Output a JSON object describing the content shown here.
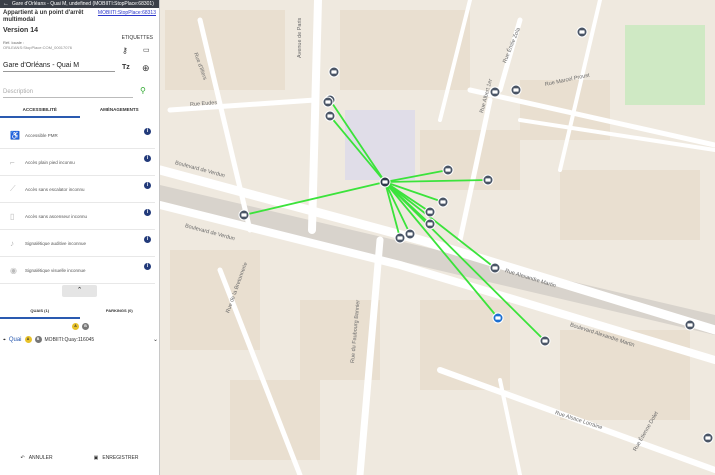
{
  "window": {
    "title": "Gare d'Orléans - Quai M, undefined (MOBIITI:StopPlace:68301)"
  },
  "header": {
    "stop_type": "Appartient à un point d'arrêt multimodal",
    "stop_link": "MOBIITI:StopPlace:68313",
    "version": "Version 14",
    "tags_label": "ETIQUETTES",
    "ref_label": "Réf. locale :",
    "ref_value": "ORLEANS:StopPlace:COM_00017076"
  },
  "fields": {
    "name": "Gare d'Orléans - Quai M",
    "description_placeholder": "Description"
  },
  "tabs": [
    {
      "label": "ACCESSIBILITÉ"
    },
    {
      "label": "AMÉNAGEMENTS"
    }
  ],
  "accessibility": [
    {
      "label": "Accessible PMR",
      "icon": "wheelchair-icon"
    },
    {
      "label": "Accès plain pied inconnu",
      "icon": "step-icon"
    },
    {
      "label": "Accès sans escalator inconnu",
      "icon": "escalator-icon"
    },
    {
      "label": "Accès sans ascenseur inconnu",
      "icon": "elevator-icon"
    },
    {
      "label": "Signalétique auditive inconnue",
      "icon": "audio-icon"
    },
    {
      "label": "Signalétique visuelle inconnue",
      "icon": "eye-icon"
    }
  ],
  "collapse_glyph": "⌃",
  "quay_tabs": [
    {
      "label": "QUAIS (1)"
    },
    {
      "label": "PARKINGS (0)"
    }
  ],
  "legend": [
    {
      "label": "A",
      "color": "#e8c22a"
    },
    {
      "label": "B",
      "color": "#777777"
    }
  ],
  "quay": {
    "label": "Quai",
    "id": "MOBIITI:Quay:116045",
    "badges": [
      "A",
      "B"
    ]
  },
  "footer": {
    "cancel_label": "ANNULER",
    "save_label": "ENREGISTRER"
  },
  "map": {
    "accent_line": "#3be33b",
    "street_labels": [
      "Boulevard de Verdun",
      "Boulevard de Verdun",
      "Rue Alexandre Martin",
      "Boulevard Alexandre Martin",
      "Rue Marcel Proust",
      "Rue Albert 1er",
      "Avenue de Paris",
      "Rue Émile Zola",
      "Rue d'Illiers",
      "Rue de la Bretonnerie",
      "Rue Eudes",
      "Rue Alsace Lorraine",
      "Rue du Faubourg Bannier",
      "Rue Étienne Dolet"
    ]
  }
}
